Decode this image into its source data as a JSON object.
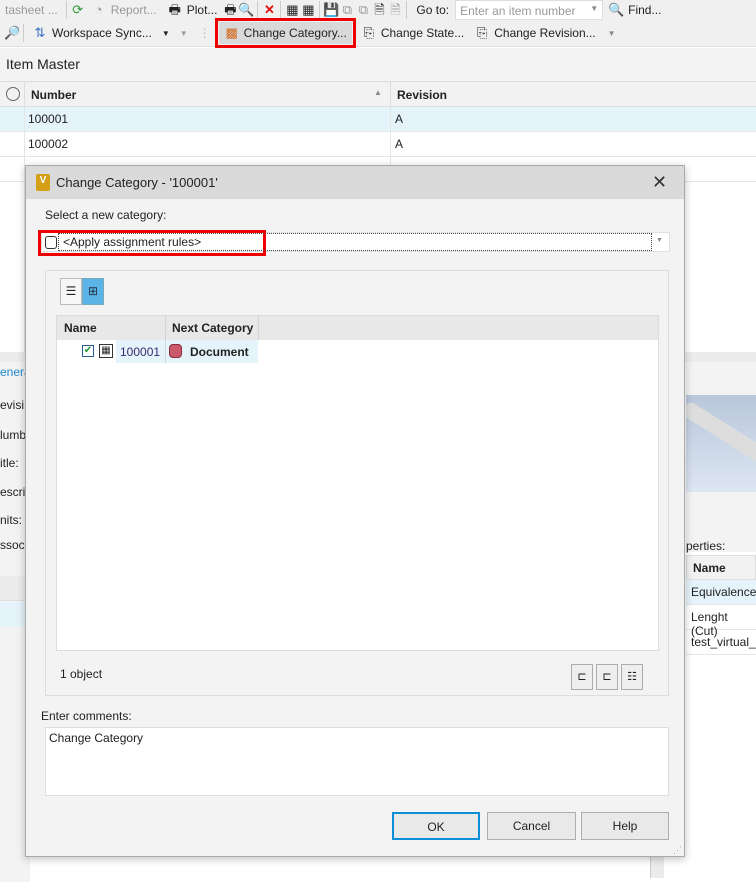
{
  "toolbar1": {
    "items": [
      "tasheet ...",
      "Report...",
      "Plot..."
    ],
    "goto_label": "Go to:",
    "goto_placeholder": "Enter an item number",
    "find": "Find..."
  },
  "toolbar2": {
    "workspace_sync": "Workspace Sync...",
    "change_category": "Change Category...",
    "change_state": "Change State...",
    "change_revision": "Change Revision..."
  },
  "item_master": {
    "title": "Item Master",
    "columns": [
      "Number",
      "Revision"
    ],
    "rows": [
      {
        "number": "100001",
        "revision": "A"
      },
      {
        "number": "100002",
        "revision": "A"
      }
    ]
  },
  "details": {
    "tab": "enera",
    "labels": [
      "evisi",
      "lumb",
      "itle:",
      "escri",
      "nits:",
      "ssoc"
    ]
  },
  "right_panel": {
    "properties_label": "perties:",
    "name_header": "Name",
    "rows": [
      "Equivalence",
      "Lenght (Cut)",
      "test_virtual_p"
    ]
  },
  "dialog": {
    "title": "Change Category - '100001'",
    "select_label": "Select a new category:",
    "combo_value": "<Apply assignment rules>",
    "grid": {
      "columns": [
        "Name",
        "Next Category"
      ],
      "rows": [
        {
          "name": "100001",
          "next_category": "Document",
          "color": "#c9596b",
          "checked": true
        }
      ]
    },
    "count": "1 object",
    "comments_label": "Enter comments:",
    "comments_value": "Change Category",
    "ok": "OK",
    "cancel": "Cancel",
    "help": "Help"
  }
}
